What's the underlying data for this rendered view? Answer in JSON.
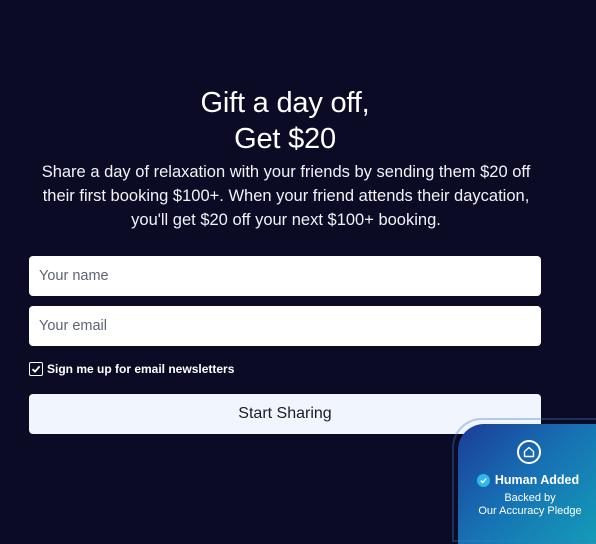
{
  "hero": {
    "title_line1": "Gift a day off,",
    "title_line2": "Get $20",
    "description": "Share a day of relaxation with your friends by sending them $20 off their first booking $100+. When your friend attends their daycation, you'll get $20 off your next $100+ booking."
  },
  "form": {
    "name_placeholder": "Your name",
    "email_placeholder": "Your email",
    "newsletter_label": "Sign me up for email newsletters",
    "newsletter_checked": true,
    "submit_label": "Start Sharing"
  },
  "badge": {
    "icon": "home-shield-icon",
    "title": "Human Added",
    "line1": "Backed by",
    "line2": "Our Accuracy Pledge"
  },
  "colors": {
    "background": "#0b0b26",
    "button_bg": "#f1f5fd",
    "badge_start": "#1b3d97",
    "badge_end": "#13a0b8"
  }
}
